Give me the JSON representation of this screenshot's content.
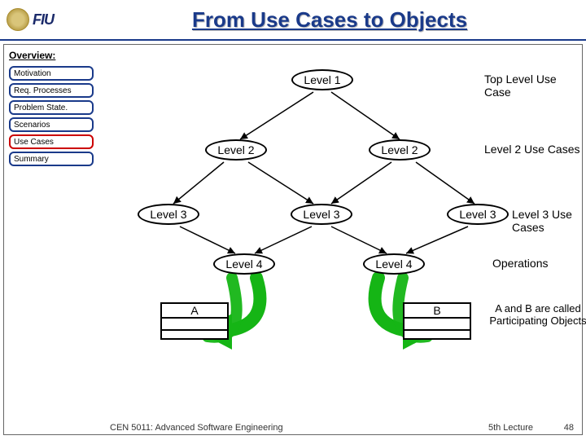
{
  "header": {
    "logo_text": "FIU",
    "title": "From Use Cases to Objects"
  },
  "sidebar": {
    "heading": "Overview:",
    "items": [
      {
        "label": "Motivation",
        "active": false
      },
      {
        "label": "Req. Processes",
        "active": false
      },
      {
        "label": "Problem State.",
        "active": false
      },
      {
        "label": "Scenarios",
        "active": false
      },
      {
        "label": "Use Cases",
        "active": true
      },
      {
        "label": "Summary",
        "active": false
      }
    ]
  },
  "diagram": {
    "nodes": {
      "level1": "Level 1",
      "level2a": "Level 2",
      "level2b": "Level 2",
      "level3a": "Level 3",
      "level3b": "Level 3",
      "level3c": "Level 3",
      "level4a": "Level 4",
      "level4b": "Level 4",
      "objA": "A",
      "objB": "B"
    },
    "row_labels": {
      "r1": "Top Level Use Case",
      "r2": "Level 2 Use Cases",
      "r3": "Level 3 Use Cases",
      "r4": "Operations",
      "r5": "A and B are called Participating Objects"
    }
  },
  "footer": {
    "course": "CEN 5011: Advanced Software Engineering",
    "lecture": "5th Lecture",
    "page": "48"
  }
}
